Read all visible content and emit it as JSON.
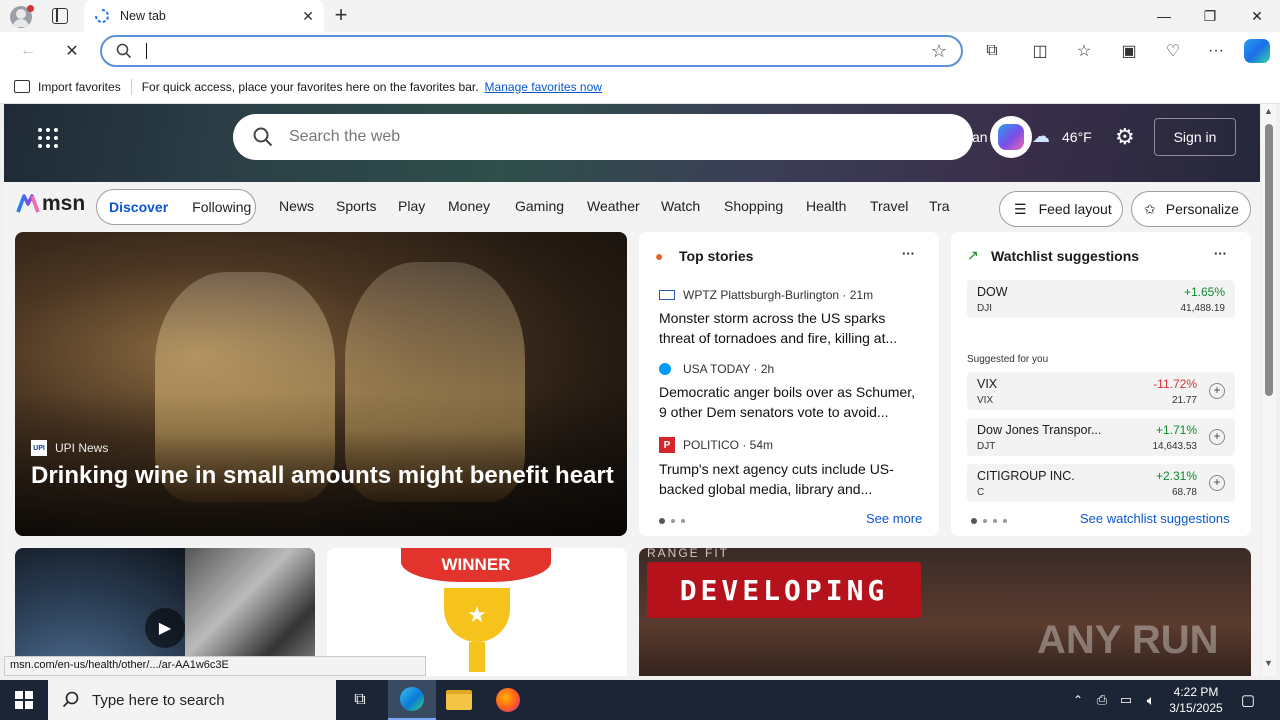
{
  "browser": {
    "tab_title": "New tab",
    "address_value": "",
    "favorites_bar": {
      "import_label": "Import favorites",
      "hint_text": "For quick access, place your favorites here on the favorites bar.",
      "manage_link": "Manage favorites now"
    },
    "status_url": "msn.com/en-us/health/other/.../ar-AA1w6c3E"
  },
  "msn": {
    "search_placeholder": "Search the web",
    "location_partial": "an",
    "weather_temp": "46°F",
    "signin_label": "Sign in",
    "logo_text": "msn",
    "toggle": {
      "discover": "Discover",
      "following": "Following"
    },
    "nav_items": [
      "News",
      "Sports",
      "Play",
      "Money",
      "Gaming",
      "Weather",
      "Watch",
      "Shopping",
      "Health",
      "Travel",
      "Tra"
    ],
    "feed_layout_label": "Feed layout",
    "personalize_label": "Personalize",
    "hero": {
      "source": "UPI News",
      "headline": "Drinking wine in small amounts might benefit heart"
    },
    "top_stories": {
      "title": "Top stories",
      "more_label": "···",
      "items": [
        {
          "source": "WPTZ Plattsburgh-Burlington · 21m",
          "headline": "Monster storm across the US sparks threat of tornadoes and fire, killing at..."
        },
        {
          "source": "USA TODAY · 2h",
          "headline": "Democratic anger boils over as Schumer, 9 other Dem senators vote to avoid..."
        },
        {
          "source": "POLITICO · 54m",
          "headline": "Trump's next agency cuts include US-backed global media, library and..."
        }
      ],
      "see_more": "See more"
    },
    "watchlist": {
      "title": "Watchlist suggestions",
      "more_label": "···",
      "primary": {
        "name": "DOW",
        "symbol": "DJI",
        "change": "+1.65%",
        "value": "41,488.19"
      },
      "suggested_label": "Suggested for you",
      "suggested": [
        {
          "name": "VIX",
          "symbol": "VIX",
          "change": "-11.72%",
          "value": "21.77"
        },
        {
          "name": "Dow Jones Transpor...",
          "symbol": "DJT",
          "change": "+1.71%",
          "value": "14,643.53"
        },
        {
          "name": "CITIGROUP INC.",
          "symbol": "C",
          "change": "+2.31%",
          "value": "68.78"
        }
      ],
      "see_link": "See watchlist suggestions"
    },
    "bottom_cards": {
      "winner_text": "WINNER",
      "developing_text": "DEVELOPING",
      "range_partial": "RANGE FIT"
    },
    "watermark": "ANY RUN"
  },
  "taskbar": {
    "search_placeholder": "Type here to search",
    "time": "4:22 PM",
    "date": "3/15/2025"
  },
  "colors": {
    "accent": "#0b57d0",
    "positive": "#0b8a2a",
    "negative": "#d13438"
  }
}
